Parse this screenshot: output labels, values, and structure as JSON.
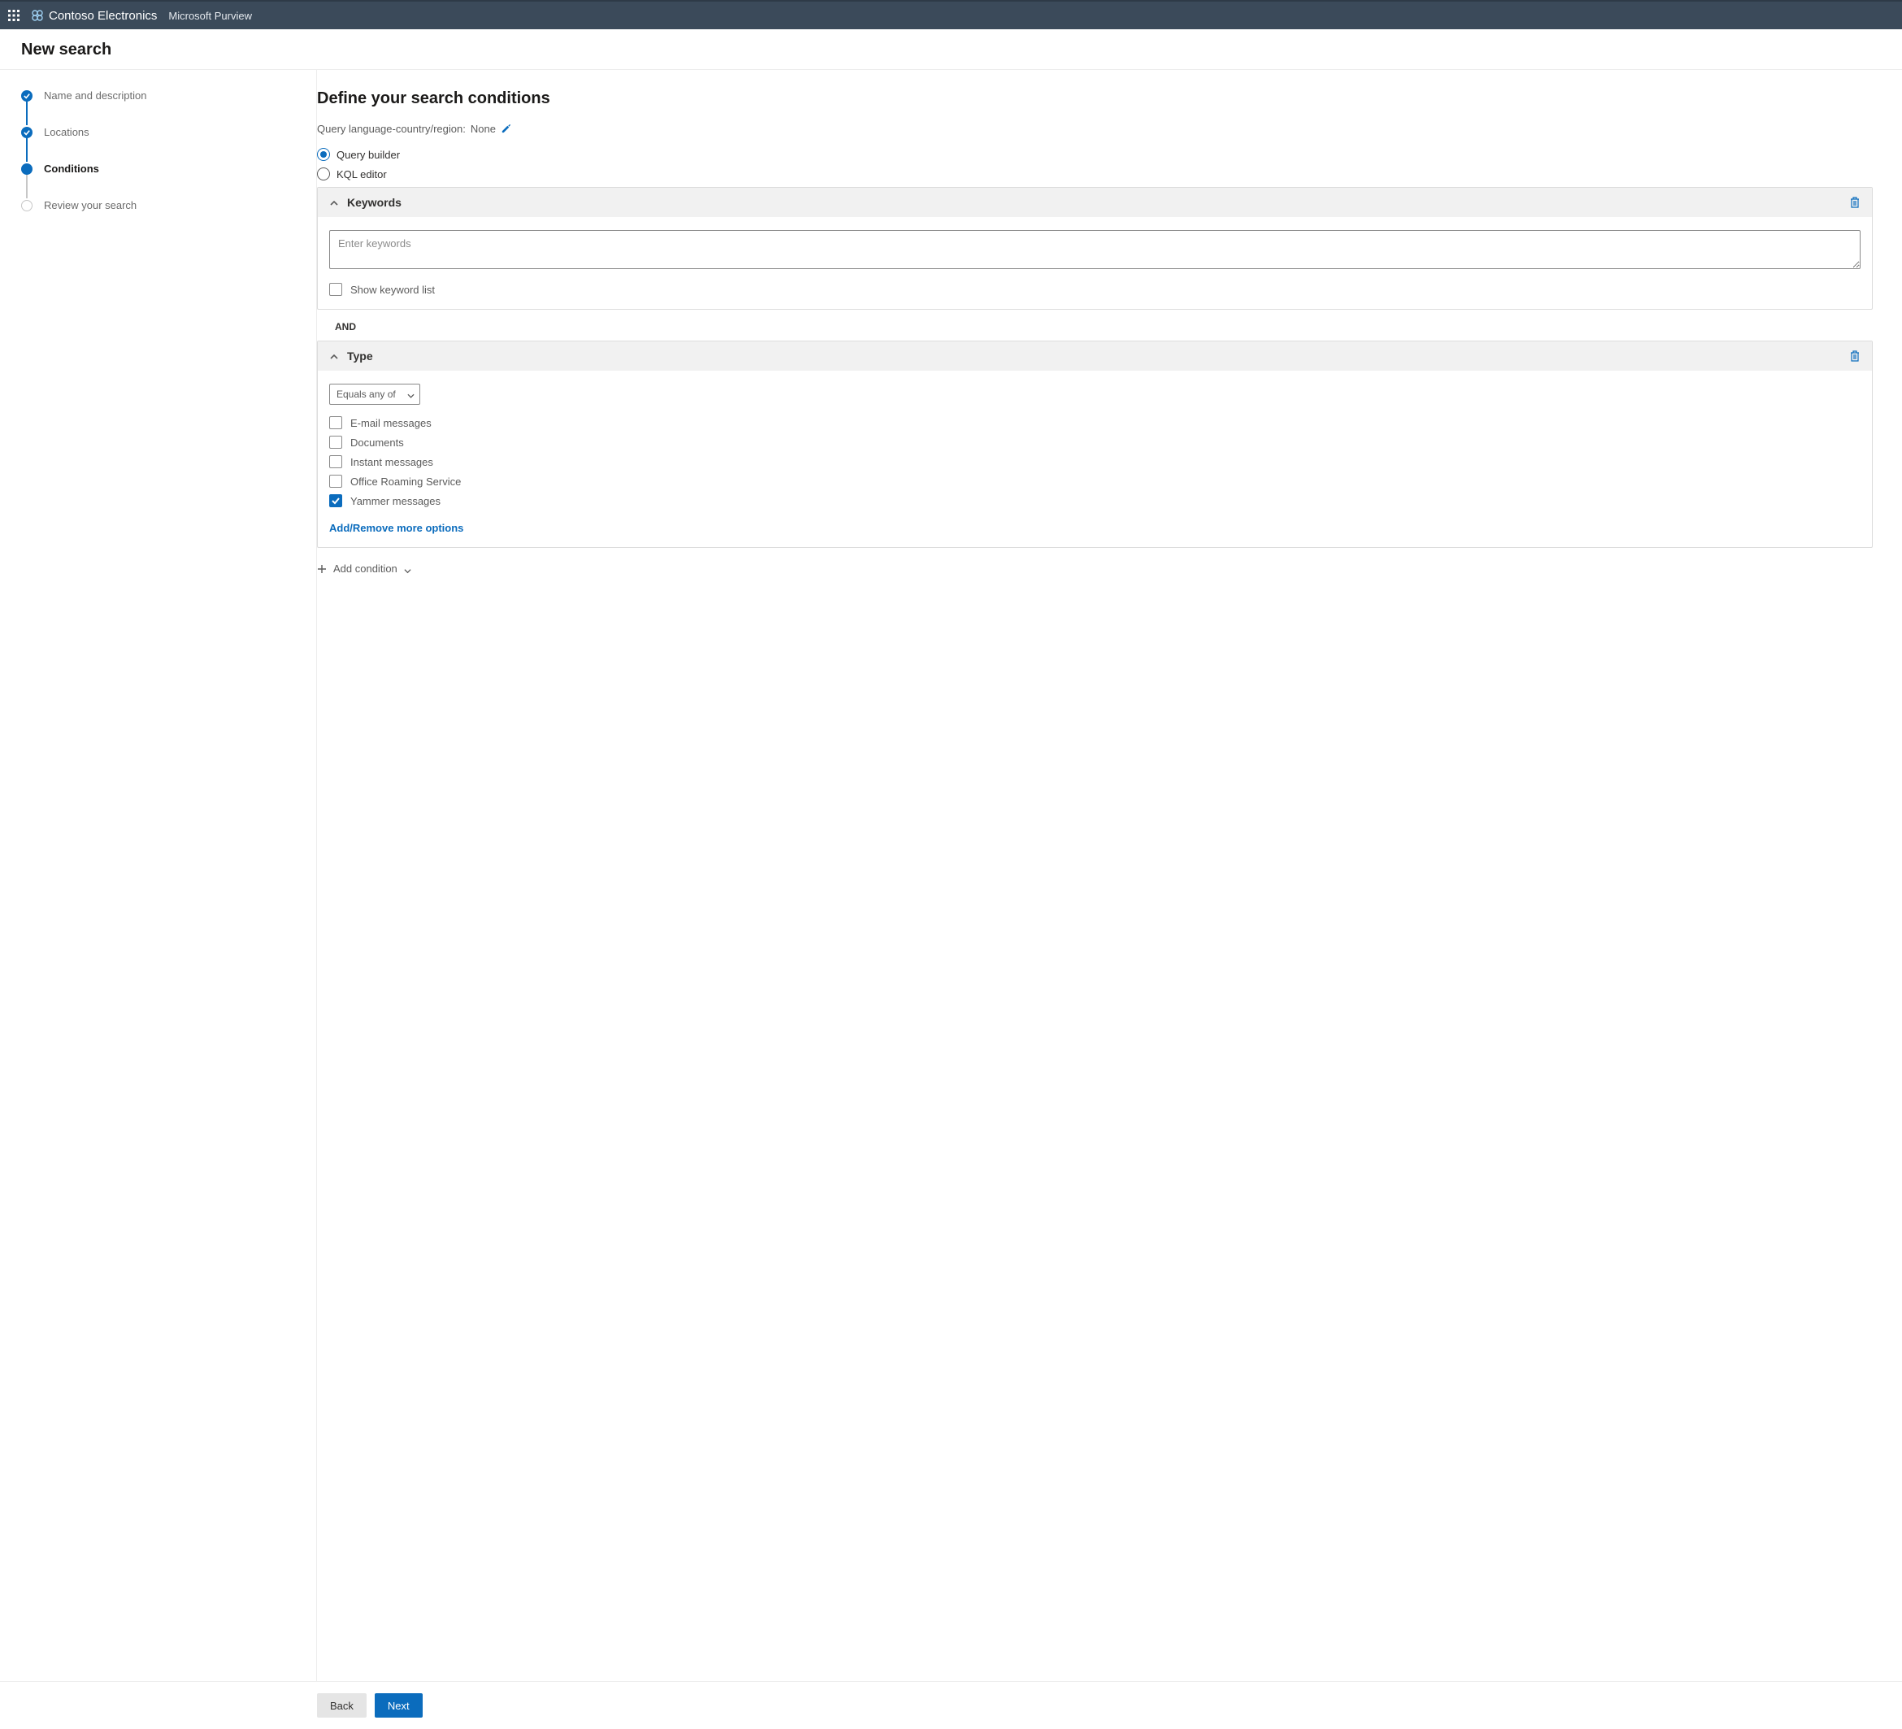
{
  "topbar": {
    "org": "Contoso Electronics",
    "service": "Microsoft Purview"
  },
  "page_title": "New search",
  "sidebar": {
    "steps": [
      {
        "label": "Name and description",
        "state": "completed"
      },
      {
        "label": "Locations",
        "state": "completed"
      },
      {
        "label": "Conditions",
        "state": "current"
      },
      {
        "label": "Review your search",
        "state": "future"
      }
    ]
  },
  "main": {
    "heading": "Define your search conditions",
    "query_lang_label": "Query language-country/region:",
    "query_lang_value": "None",
    "radio_query_builder": "Query builder",
    "radio_kql_editor": "KQL editor",
    "keywords_card": {
      "title": "Keywords",
      "placeholder": "Enter keywords",
      "show_keyword_list": "Show keyword list"
    },
    "and_separator": "AND",
    "type_card": {
      "title": "Type",
      "operator": "Equals any of",
      "options": [
        {
          "label": "E-mail messages",
          "checked": false
        },
        {
          "label": "Documents",
          "checked": false
        },
        {
          "label": "Instant messages",
          "checked": false
        },
        {
          "label": "Office Roaming Service",
          "checked": false
        },
        {
          "label": "Yammer messages",
          "checked": true
        }
      ],
      "more_options": "Add/Remove more options"
    },
    "add_condition": "Add condition"
  },
  "footer": {
    "back": "Back",
    "next": "Next"
  }
}
